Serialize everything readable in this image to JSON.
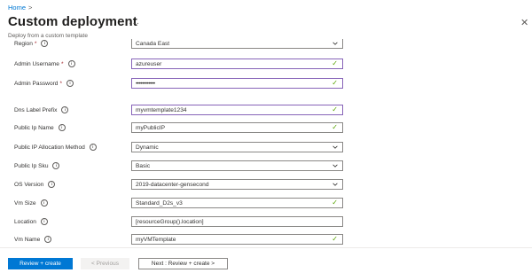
{
  "breadcrumb": {
    "home": "Home",
    "separator": ">"
  },
  "header": {
    "title": "Custom deployment",
    "more": "···",
    "subtitle": "Deploy from a custom template",
    "close": "✕"
  },
  "form": {
    "required_marker": "*",
    "info_glyph": "i",
    "check_glyph": "✓",
    "fields": [
      {
        "label": "Region",
        "required": true,
        "value": "Canada East",
        "kind": "dropdown"
      },
      {
        "label": "Admin Username",
        "required": true,
        "value": "azureuser",
        "kind": "text"
      },
      {
        "label": "Admin Password",
        "required": true,
        "value": "••••••••••••",
        "kind": "password"
      },
      {
        "label": "Dns Label Prefix",
        "required": false,
        "value": "myvmtemplate1234",
        "kind": "text"
      },
      {
        "label": "Public Ip Name",
        "required": false,
        "value": "myPublicIP",
        "kind": "text"
      },
      {
        "label": "Public IP Allocation Method",
        "required": false,
        "value": "Dynamic",
        "kind": "dropdown"
      },
      {
        "label": "Public Ip Sku",
        "required": false,
        "value": "Basic",
        "kind": "dropdown"
      },
      {
        "label": "OS Version",
        "required": false,
        "value": "2019-datacenter-gensecond",
        "kind": "dropdown"
      },
      {
        "label": "Vm Size",
        "required": false,
        "value": "Standard_D2s_v3",
        "kind": "text"
      },
      {
        "label": "Location",
        "required": false,
        "value": "[resourceGroup().location]",
        "kind": "text"
      },
      {
        "label": "Vm Name",
        "required": false,
        "value": "myVMTemplate",
        "kind": "text"
      }
    ]
  },
  "footer": {
    "review_create": "Review + create",
    "previous": "< Previous",
    "next": "Next : Review + create >"
  },
  "colors": {
    "accent": "#0078d4",
    "valid_border": "#8764b8",
    "check": "#57a300",
    "required": "#a4262c"
  }
}
